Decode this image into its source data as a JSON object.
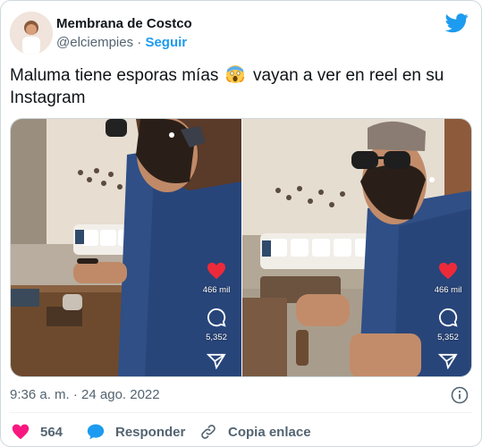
{
  "author": {
    "display_name": "Membrana de Costco",
    "handle": "@elciempies",
    "separator": "·",
    "follow_label": "Seguir"
  },
  "tweet": {
    "text_before_emoji": "Maluma tiene esporas mías",
    "emoji_name": "screaming-face-emoji",
    "text_after_emoji": "vayan a ver en reel en su Instagram"
  },
  "media": {
    "left": {
      "likes": "466 mil",
      "comments": "5,352"
    },
    "right": {
      "likes": "466 mil",
      "comments": "5,352"
    }
  },
  "meta": {
    "timestamp": "9:36 a. m. · 24 ago. 2022"
  },
  "actions": {
    "like_count": "564",
    "reply_label": "Responder",
    "copy_link_label": "Copia enlace"
  },
  "colors": {
    "accent": "#1d9bf0",
    "like": "#f91880",
    "text": "#0f1419",
    "muted": "#536471"
  }
}
